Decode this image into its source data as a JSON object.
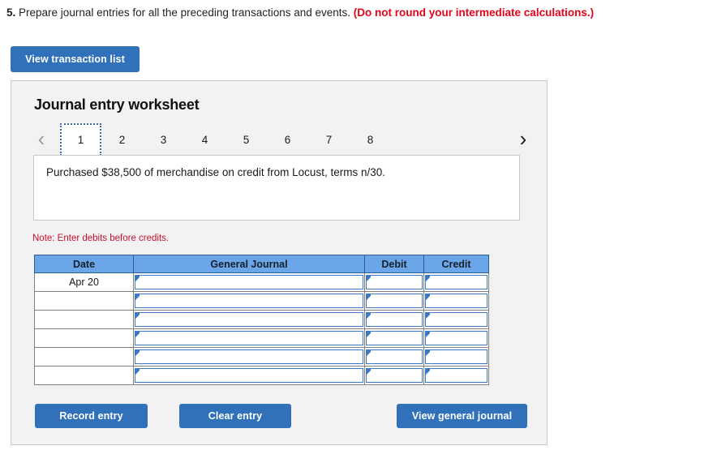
{
  "question": {
    "number": "5.",
    "text": "Prepare journal entries for all the preceding transactions and events.",
    "warning": "(Do not round your intermediate calculations.)"
  },
  "toolbar": {
    "view_transaction_list": "View transaction list"
  },
  "panel": {
    "title": "Journal entry worksheet",
    "nav": {
      "prev_icon": "‹",
      "next_icon": "›"
    },
    "tabs": [
      {
        "label": "1",
        "active": true
      },
      {
        "label": "2",
        "active": false
      },
      {
        "label": "3",
        "active": false
      },
      {
        "label": "4",
        "active": false
      },
      {
        "label": "5",
        "active": false
      },
      {
        "label": "6",
        "active": false
      },
      {
        "label": "7",
        "active": false
      },
      {
        "label": "8",
        "active": false
      }
    ],
    "description": "Purchased $38,500 of merchandise on credit from Locust, terms n/30.",
    "note": "Note: Enter debits before credits.",
    "table": {
      "headers": [
        "Date",
        "General Journal",
        "Debit",
        "Credit"
      ],
      "rows": [
        {
          "date": "Apr 20",
          "general_journal": "",
          "debit": "",
          "credit": ""
        },
        {
          "date": "",
          "general_journal": "",
          "debit": "",
          "credit": ""
        },
        {
          "date": "",
          "general_journal": "",
          "debit": "",
          "credit": ""
        },
        {
          "date": "",
          "general_journal": "",
          "debit": "",
          "credit": ""
        },
        {
          "date": "",
          "general_journal": "",
          "debit": "",
          "credit": ""
        },
        {
          "date": "",
          "general_journal": "",
          "debit": "",
          "credit": ""
        }
      ]
    },
    "actions": {
      "record_entry": "Record entry",
      "clear_entry": "Clear entry",
      "view_general_journal": "View general journal"
    }
  },
  "colors": {
    "button_blue": "#3071b9",
    "table_header_blue": "#6aa6e8",
    "note_red": "#c8102e",
    "warning_red": "#e3061a",
    "panel_background": "#f2f2f2",
    "input_border_blue": "#3b79c4"
  }
}
